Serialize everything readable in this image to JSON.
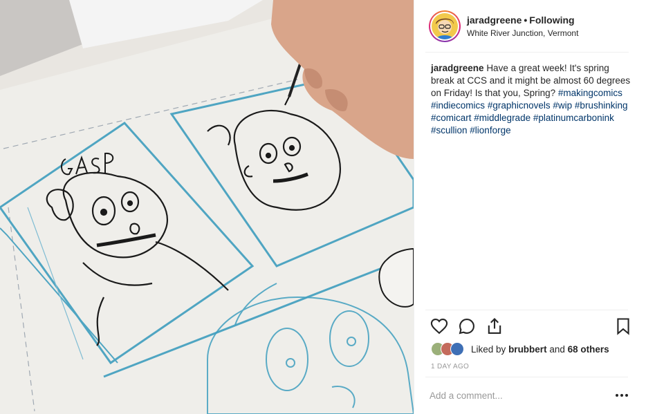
{
  "post": {
    "photo_alt": "Hand inking comic panels with a brush on bristol board"
  },
  "header": {
    "username": "jaradgreene",
    "separator": "•",
    "follow_status": "Following",
    "location": "White River Junction, Vermont"
  },
  "caption": {
    "username": "jaradgreene",
    "text": "Have a great week! It's spring break at CCS and it might be almost 60 degrees on Friday! Is that you, Spring?",
    "hashtags": [
      "#makingcomics",
      "#indiecomics",
      "#graphicnovels",
      "#wip",
      "#brushinking",
      "#comicart",
      "#middlegrade",
      "#platinumcarbonink",
      "#scullion",
      "#lionforge"
    ]
  },
  "actions": {
    "like_icon": "heart-icon",
    "comment_icon": "comment-icon",
    "share_icon": "share-icon",
    "save_icon": "bookmark-icon"
  },
  "likes": {
    "prefix": "Liked by",
    "liked_by": "brubbert",
    "conjunction": "and",
    "others": "68 others"
  },
  "timestamp": "1 DAY AGO",
  "comment": {
    "placeholder": "Add a comment...",
    "more_icon": "more-options-icon"
  },
  "colors": {
    "hashtag": "#003569",
    "muted": "#999999",
    "text": "#262626",
    "divider": "#efefef",
    "story_ring": "#dd2a7b"
  }
}
